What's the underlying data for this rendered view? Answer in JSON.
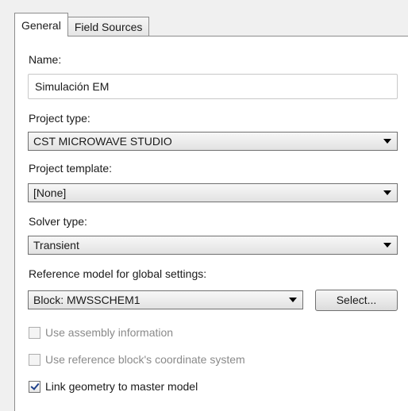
{
  "tabs": [
    {
      "label": "General",
      "active": true
    },
    {
      "label": "Field Sources",
      "active": false
    }
  ],
  "name": {
    "label": "Name:",
    "value": "Simulación EM"
  },
  "project_type": {
    "label": "Project type:",
    "value": "CST MICROWAVE STUDIO"
  },
  "project_template": {
    "label": "Project template:",
    "value": "[None]"
  },
  "solver_type": {
    "label": "Solver type:",
    "value": "Transient"
  },
  "reference_model": {
    "label": "Reference model for global settings:",
    "value": "Block: MWSSCHEM1",
    "select_button": "Select..."
  },
  "checkboxes": [
    {
      "label": "Use assembly information",
      "checked": false,
      "enabled": false
    },
    {
      "label": "Use reference block's coordinate system",
      "checked": false,
      "enabled": false
    },
    {
      "label": "Link geometry to master model",
      "checked": true,
      "enabled": true
    }
  ],
  "icons": {
    "dropdown": "chevron-down-icon",
    "check": "checkmark-icon"
  }
}
